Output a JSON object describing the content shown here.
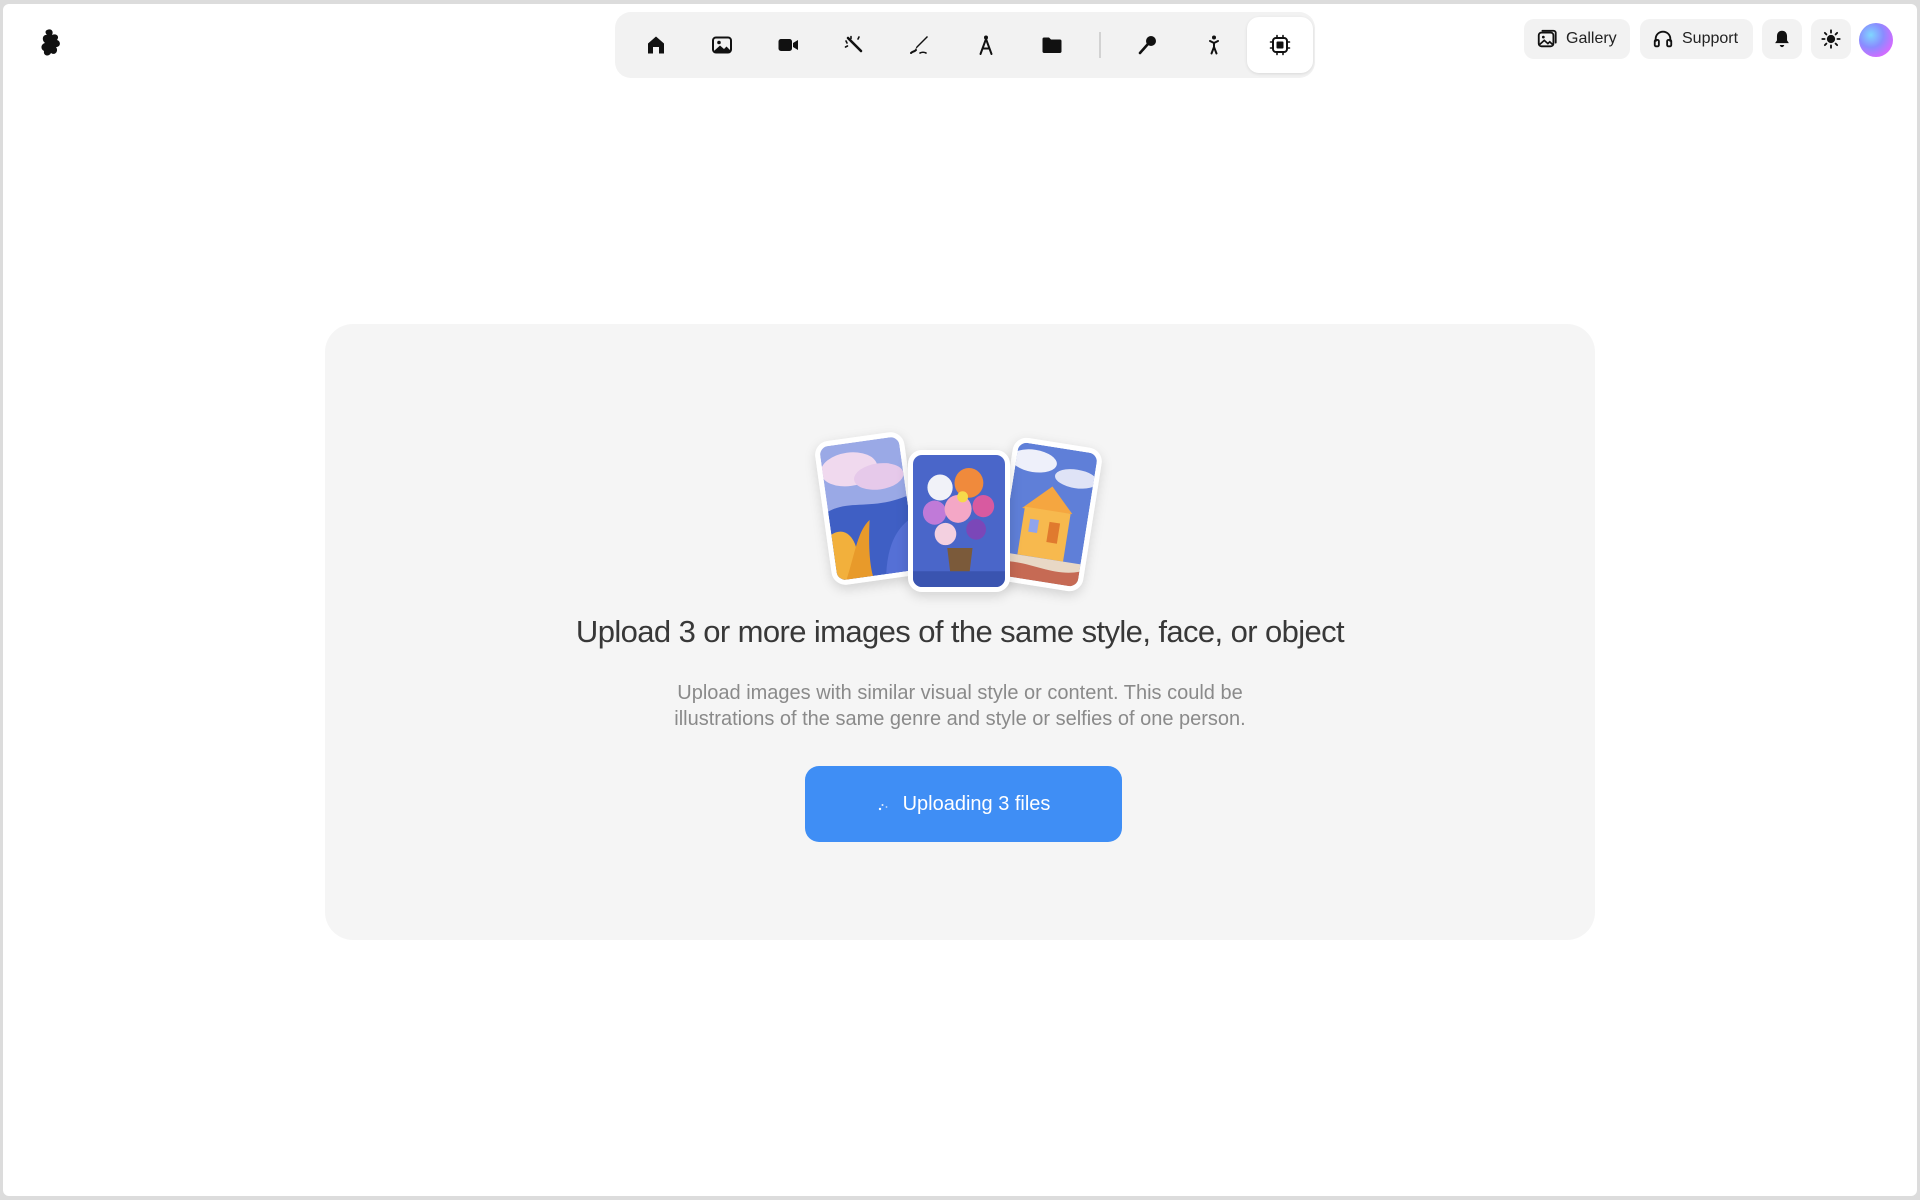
{
  "app": {
    "logo_icon": "blob-logo-icon"
  },
  "topnav": {
    "items": [
      {
        "icon": "home-icon",
        "active": false
      },
      {
        "icon": "image-icon",
        "active": false
      },
      {
        "icon": "video-camera-icon",
        "active": false
      },
      {
        "icon": "magic-wand-icon",
        "active": false
      },
      {
        "icon": "pen-brush-icon",
        "active": false
      },
      {
        "icon": "compass-draw-icon",
        "active": false
      },
      {
        "icon": "folder-icon",
        "active": false
      },
      {
        "icon": "microphone-icon",
        "active": false
      },
      {
        "icon": "figure-pose-icon",
        "active": false
      },
      {
        "icon": "chip-train-icon",
        "active": true
      }
    ]
  },
  "header": {
    "gallery_label": "Gallery",
    "support_label": "Support"
  },
  "upload": {
    "title": "Upload 3 or more images of the same style, face, or object",
    "description": "Upload images with similar visual style or content. This could be illustrations of the same genre and style or selfies of one person.",
    "button_label": "Uploading 3 files"
  },
  "colors": {
    "accent": "#3f8ef5",
    "card_background": "#f5f5f5",
    "nav_background": "#f2f2f2"
  }
}
